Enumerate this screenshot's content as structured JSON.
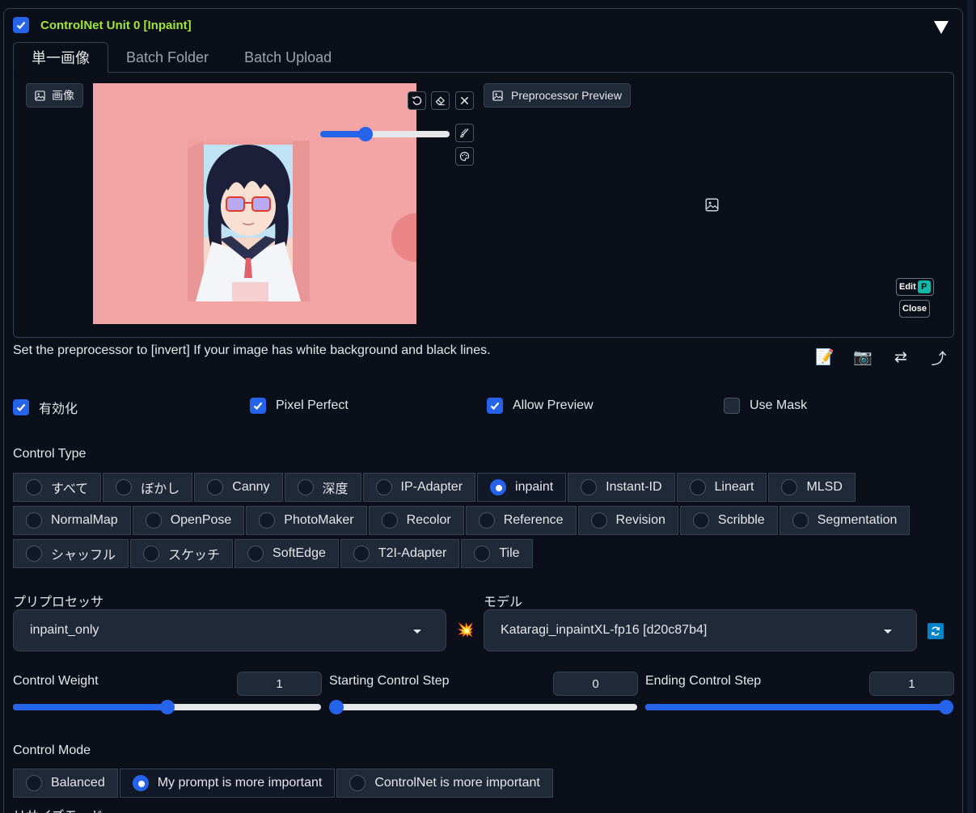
{
  "unit": {
    "title": "ControlNet Unit 0  [Inpaint]",
    "enabled": true
  },
  "tabs": [
    {
      "label": "単一画像",
      "active": true
    },
    {
      "label": "Batch Folder",
      "active": false
    },
    {
      "label": "Batch Upload",
      "active": false
    }
  ],
  "image_panel": {
    "label": "画像",
    "brush_size_fraction": 0.33
  },
  "preview_panel": {
    "label": "Preprocessor Preview",
    "edit_label": "Edit",
    "close_label": "Close"
  },
  "hint": "Set the preprocessor to [invert] If your image has white background and black lines.",
  "action_icons": [
    "memo-icon",
    "camera-icon",
    "swap-icon",
    "curved-arrow-icon"
  ],
  "options": [
    {
      "label": "有効化",
      "checked": true
    },
    {
      "label": "Pixel Perfect",
      "checked": true
    },
    {
      "label": "Allow Preview",
      "checked": true
    },
    {
      "label": "Use Mask",
      "checked": false
    }
  ],
  "control_type": {
    "label": "Control Type",
    "rows": [
      [
        "すべて",
        "ぼかし",
        "Canny",
        "深度",
        "IP-Adapter",
        "inpaint",
        "Instant-ID",
        "Lineart",
        "MLSD"
      ],
      [
        "NormalMap",
        "OpenPose",
        "PhotoMaker",
        "Recolor",
        "Reference",
        "Revision",
        "Scribble",
        "Segmentation"
      ],
      [
        "シャッフル",
        "スケッチ",
        "SoftEdge",
        "T2I-Adapter",
        "Tile"
      ]
    ],
    "selected": "inpaint"
  },
  "preprocessor": {
    "label": "プリプロセッサ",
    "value": "inpaint_only"
  },
  "model": {
    "label": "モデル",
    "value": "Kataragi_inpaintXL-fp16 [d20c87b4]"
  },
  "sliders": [
    {
      "label": "Control Weight",
      "value": "1",
      "fraction": 0.5
    },
    {
      "label": "Starting Control Step",
      "value": "0",
      "fraction": 0
    },
    {
      "label": "Ending Control Step",
      "value": "1",
      "fraction": 1
    }
  ],
  "control_mode": {
    "label": "Control Mode",
    "options": [
      "Balanced",
      "My prompt is more important",
      "ControlNet is more important"
    ],
    "selected": "My prompt is more important"
  },
  "next_section_label": "リサイズモード",
  "colors": {
    "accent": "#2563eb",
    "title": "#a3e635",
    "background": "#0b0f19",
    "canvas": "#f3a5a5"
  }
}
